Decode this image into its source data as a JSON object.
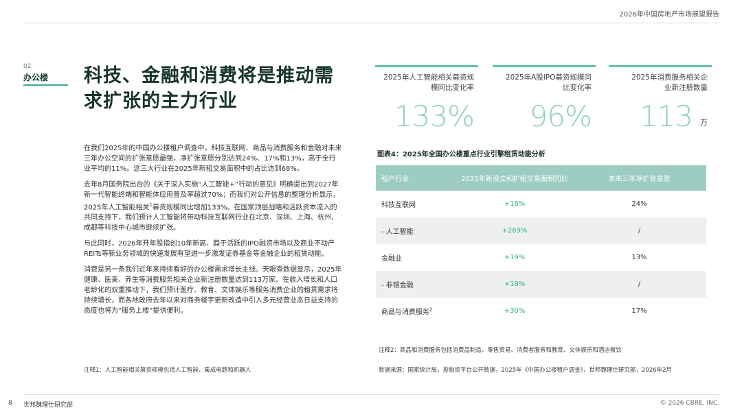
{
  "header": {
    "report_title": "2026年中国房地产市场展望报告"
  },
  "section": {
    "number": "02",
    "name": "办公楼"
  },
  "headline": "科技、金融和消费将是推动需求扩张的主力行业",
  "body": {
    "p1": "在我们2025年的中国办公楼租户调查中，科技互联网、商品与消费服务和金融对未来三年办公空间的扩张意愿最强，净扩张意愿分别达到24%、17%和13%，高于全行业平均的11%。这三大行业在2025年新租交易面积中的占比达到68%。",
    "p2a": "去年8月国务院出台的《关于深入实施“人工智能+”行动的意见》明确提出到2027年新一代智能终端和智能体应用普及率超过70%；而我们对公开信息的整理分析显示，2025年人工智能相关",
    "p2_sup": "1",
    "p2b": "募资规模同比增加133%。在国家顶层战略和活跃资本流入的共同支持下，我们预计人工智能将带动科技互联网行业在北京、深圳、上海、杭州、成都等科技中心城市继续扩张。",
    "p3": "与此同时，2026年开年股指创10年新高、趋于活跃的IPO融资市场以及商业不动产REITs等新业务领域的快速发展有望进一步激发证券基金等金融企业的租赁动能。",
    "p4": "消费是另一条我们近年来持续看好的办公楼需求增长主线。天眼查数据显示，2025年健康、医美、养生等消费服务相关企业新注册数量达到113万家。在收入增长和人口老龄化的双重推动下，我们预计医疗、教育、文体娱乐等服务消费企业的租赁需求将持续增长，而各地政府去年以来对商务楼宇更新改造中引入多元经营业态日益支持的态度也将为“服务上楼”提供便利。",
    "note1": "注释1：人工智能相关募资规模包括人工智能、集成电路和机器人"
  },
  "stats": [
    {
      "label": "2025年人工智能相关募资规模同比变化率",
      "value": "133%",
      "unit": ""
    },
    {
      "label": "2025年A股IPO募资规模同比变化率",
      "value": "96%",
      "unit": ""
    },
    {
      "label": "2025年消费服务相关企业新注册数量",
      "value": "113",
      "unit": "万"
    }
  ],
  "figure": {
    "title": "图表4：2025年全国办公楼重点行业引擎租赁动能分析",
    "headers": [
      "租户行业",
      "2025年新设立和扩租交易面积同比",
      "未来三年净扩张意愿"
    ],
    "rows": [
      {
        "industry": "科技互联网",
        "sup": "",
        "yoy": "+18%",
        "intent": "24%"
      },
      {
        "industry": "- 人工智能",
        "sup": "",
        "yoy": "+269%",
        "intent": "/"
      },
      {
        "industry": "金融业",
        "sup": "",
        "yoy": "+19%",
        "intent": "13%"
      },
      {
        "industry": "- 非银金融",
        "sup": "",
        "yoy": "+18%",
        "intent": "/"
      },
      {
        "industry": "商品与消费服务",
        "sup": "2",
        "yoy": "+30%",
        "intent": "17%"
      }
    ],
    "note2": "注释2：商品和消费服务包括消费品制造、零售贸易、消费者服务和教育、文体娱乐和酒店餐饮",
    "source": "数据来源：国家统计局，投融资平台公开数据，2025年《中国办公楼租户调查》，世邦魏理仕研究部，2026年2月"
  },
  "footer": {
    "page": "8",
    "org": "世邦魏理仕研究部",
    "copyright": "© 2026 CBRE, INC."
  },
  "colors": {
    "accent": "#5fc1a8",
    "table_header": "#9dcdc0",
    "positive": "#3aaf8a",
    "headline": "#17352b"
  }
}
